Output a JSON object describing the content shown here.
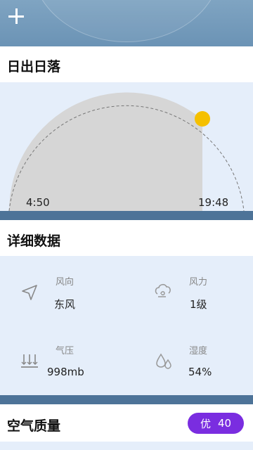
{
  "header": {
    "add_icon": "plus-icon"
  },
  "sunrise": {
    "title": "日出日落",
    "sunrise_time": "4:50",
    "sunset_time": "19:48",
    "sun_color": "#f5c000",
    "sun_icon": "sun-icon"
  },
  "details": {
    "title": "详细数据",
    "items": [
      {
        "label": "风向",
        "value": "东风",
        "icon": "navigation-arrow-icon"
      },
      {
        "label": "风力",
        "value": "1级",
        "icon": "wind-swirl-icon"
      },
      {
        "label": "气压",
        "value": "998mb",
        "icon": "pressure-icon"
      },
      {
        "label": "湿度",
        "value": "54%",
        "icon": "humidity-drops-icon"
      }
    ]
  },
  "air_quality": {
    "title": "空气质量",
    "level": "优",
    "aqi": "40",
    "badge_color": "#7a2de0"
  }
}
